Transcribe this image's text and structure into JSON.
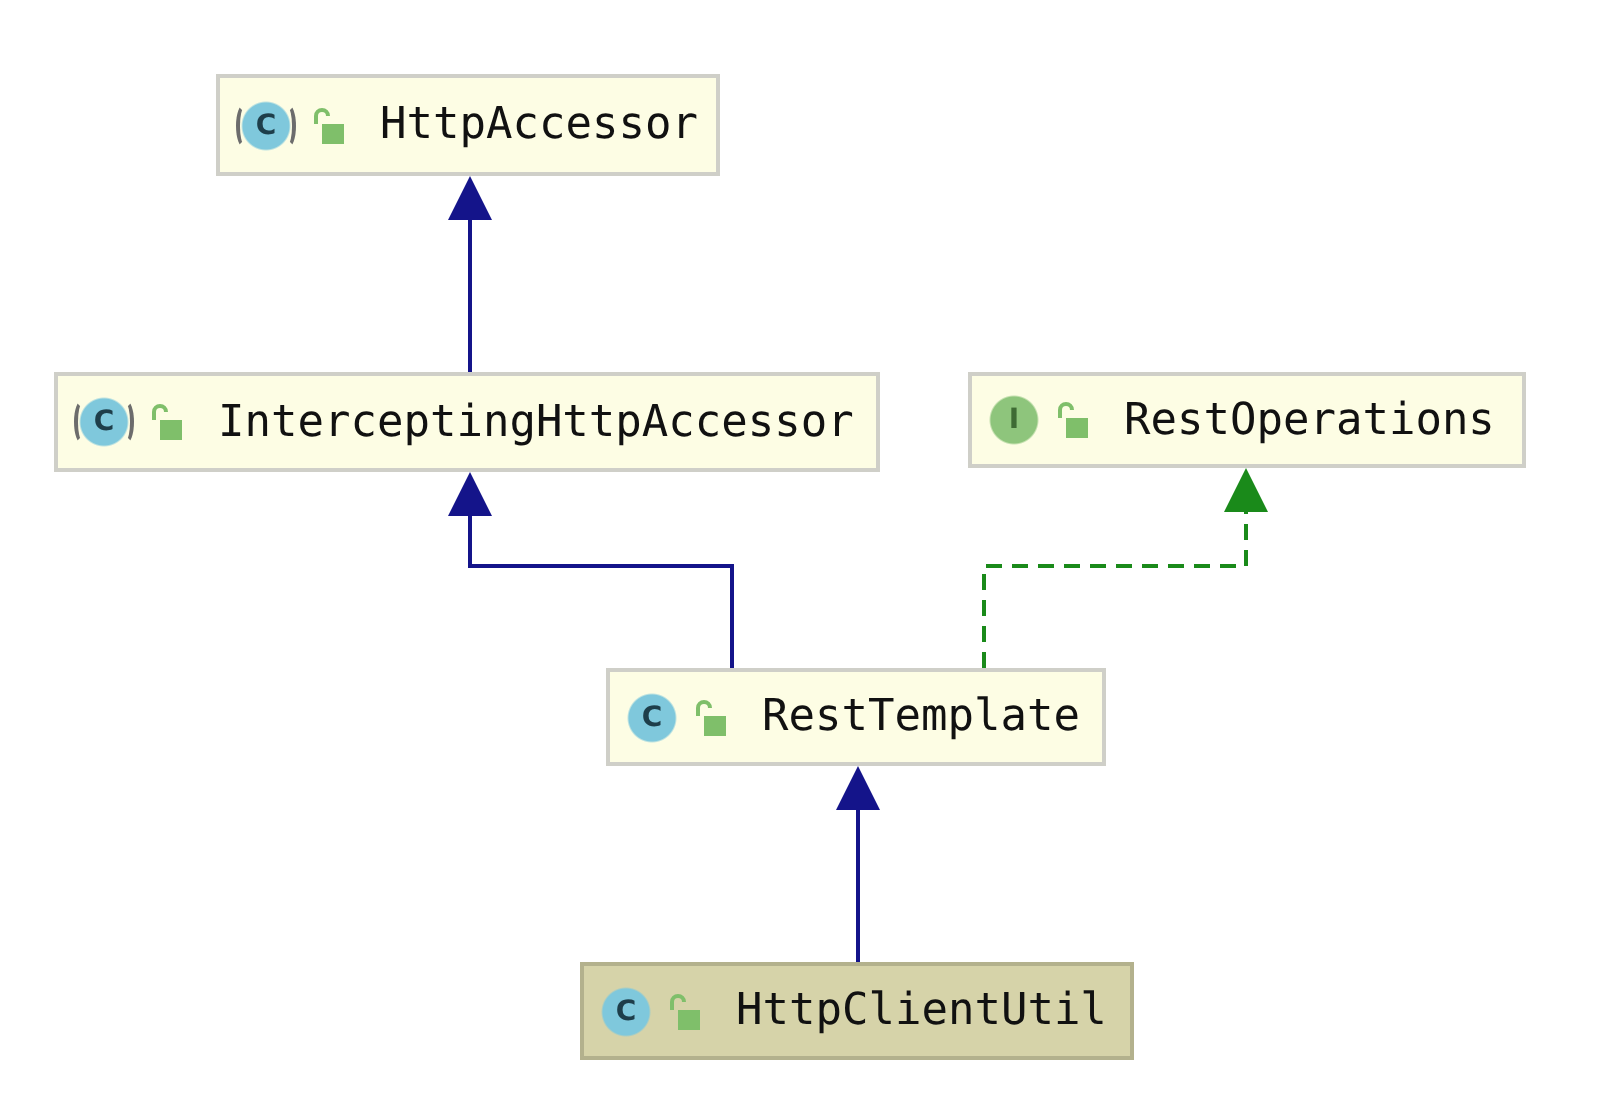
{
  "diagram": {
    "nodes": [
      {
        "name": "HttpAccessor",
        "kind": "abstract",
        "icon_letter": "C",
        "selected": false
      },
      {
        "name": "InterceptingHttpAccessor",
        "kind": "abstract",
        "icon_letter": "C",
        "selected": false
      },
      {
        "name": "RestOperations",
        "kind": "interface",
        "icon_letter": "I",
        "selected": false
      },
      {
        "name": "RestTemplate",
        "kind": "class",
        "icon_letter": "C",
        "selected": false
      },
      {
        "name": "HttpClientUtil",
        "kind": "class",
        "icon_letter": "C",
        "selected": true
      }
    ],
    "edges": [
      {
        "kind": "extends"
      },
      {
        "kind": "extends"
      },
      {
        "kind": "implements"
      },
      {
        "kind": "extends"
      }
    ]
  }
}
